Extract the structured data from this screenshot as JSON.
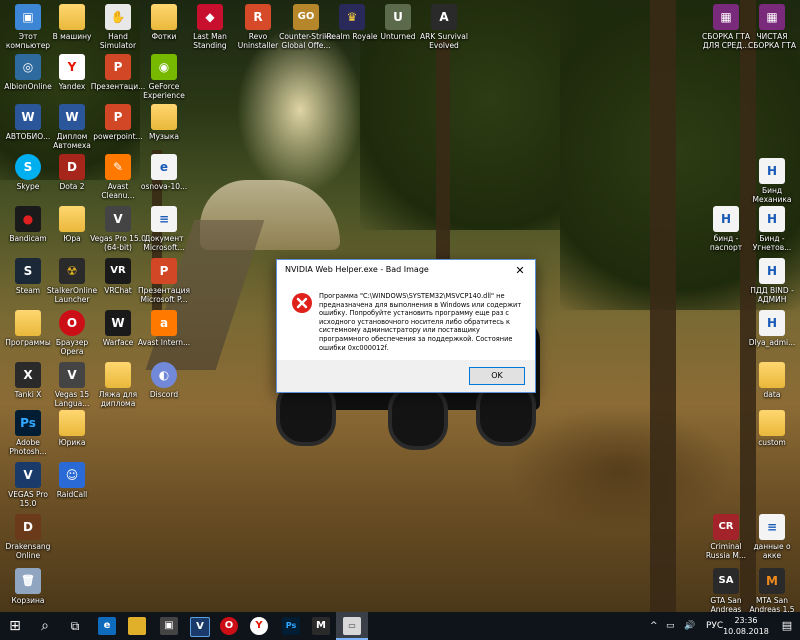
{
  "desktop": {
    "icons": [
      {
        "label": "Этот компьютер",
        "glyph": "▣",
        "bg": "#3d86d6"
      },
      {
        "label": "В машину",
        "glyph": "",
        "bg": ""
      },
      {
        "label": "Hand Simulator",
        "glyph": "✋",
        "bg": "#e8e8e8"
      },
      {
        "label": "Фотки",
        "glyph": "",
        "bg": ""
      },
      {
        "label": "Last Man Standing",
        "glyph": "◆",
        "bg": "#c8102e"
      },
      {
        "label": "Revo Uninstaller",
        "glyph": "R",
        "bg": "#d64a2a"
      },
      {
        "label": "Counter-Strike Global Offe...",
        "glyph": "GO",
        "bg": "#b5862a"
      },
      {
        "label": "Realm Royale",
        "glyph": "♛",
        "bg": "#2a2a5a"
      },
      {
        "label": "Unturned",
        "glyph": "U",
        "bg": "#5a6a4a"
      },
      {
        "label": "ARK Survival Evolved",
        "glyph": "A",
        "bg": "#2a2a2a"
      },
      {
        "label": "СБОРКА ГТА ДЛЯ СРЕД...",
        "glyph": "▦",
        "bg": "#7a2a7a"
      },
      {
        "label": "ЧИСТАЯ СБОРКА ГТА",
        "glyph": "▦",
        "bg": "#7a2a7a"
      },
      {
        "label": "AlbionOnline",
        "glyph": "◎",
        "bg": "#2f6a9e"
      },
      {
        "label": "Yandex",
        "glyph": "Y",
        "bg": "#ffffff"
      },
      {
        "label": "Презентаци...",
        "glyph": "P",
        "bg": "#d24726"
      },
      {
        "label": "GeForce Experience",
        "glyph": "◉",
        "bg": "#76b900"
      },
      {
        "label": "АВТОБИО...",
        "glyph": "W",
        "bg": "#2b579a"
      },
      {
        "label": "Диплом Автомеха",
        "glyph": "W",
        "bg": "#2b579a"
      },
      {
        "label": "powerpoint...",
        "glyph": "P",
        "bg": "#d24726"
      },
      {
        "label": "Музыка",
        "glyph": "",
        "bg": ""
      },
      {
        "label": "Skype",
        "glyph": "S",
        "bg": "#00aff0"
      },
      {
        "label": "Dota 2",
        "glyph": "D",
        "bg": "#a6261b"
      },
      {
        "label": "Avast Cleanu...",
        "glyph": "✎",
        "bg": "#ff7800"
      },
      {
        "label": "osnova-10...",
        "glyph": "e",
        "bg": "#f4f4f4"
      },
      {
        "label": "Бинд Механика",
        "glyph": "H",
        "bg": "#f4f4f4"
      },
      {
        "label": "Bandicam",
        "glyph": "●",
        "bg": "#1a1a1a"
      },
      {
        "label": "Юра",
        "glyph": "",
        "bg": ""
      },
      {
        "label": "Vegas Pro 15.0 (64-bit)",
        "glyph": "V",
        "bg": "#444444"
      },
      {
        "label": "Документ Microsoft...",
        "glyph": "≡",
        "bg": "#f4f4f4"
      },
      {
        "label": "бинд - паспорт",
        "glyph": "H",
        "bg": "#f4f4f4"
      },
      {
        "label": "Бинд - Угнетов...",
        "glyph": "H",
        "bg": "#f4f4f4"
      },
      {
        "label": "Steam",
        "glyph": "S",
        "bg": "#1b2838"
      },
      {
        "label": "StalkerOnline Launcher",
        "glyph": "☢",
        "bg": "#2a2a2a"
      },
      {
        "label": "VRChat",
        "glyph": "VR",
        "bg": "#1a1a1a"
      },
      {
        "label": "Презентация Microsoft P...",
        "glyph": "P",
        "bg": "#d24726"
      },
      {
        "label": "ПДД BIND - АДМИН",
        "glyph": "H",
        "bg": "#f4f4f4"
      },
      {
        "label": "Программы",
        "glyph": "",
        "bg": ""
      },
      {
        "label": "Браузер Opera",
        "glyph": "O",
        "bg": "#cc0f16"
      },
      {
        "label": "Warface",
        "glyph": "W",
        "bg": "#1a1a1a"
      },
      {
        "label": "Avast Intern...",
        "glyph": "a",
        "bg": "#ff7800"
      },
      {
        "label": "Dlya_admi...",
        "glyph": "H",
        "bg": "#f4f4f4"
      },
      {
        "label": "Tanki X",
        "glyph": "X",
        "bg": "#2a2a2a"
      },
      {
        "label": "Vegas 15 Langua...",
        "glyph": "V",
        "bg": "#444444"
      },
      {
        "label": "Ляжа для диплома",
        "glyph": "",
        "bg": ""
      },
      {
        "label": "Discord",
        "glyph": "◐",
        "bg": "#7289da"
      },
      {
        "label": "data",
        "glyph": "",
        "bg": ""
      },
      {
        "label": "Adobe Photosh...",
        "glyph": "Ps",
        "bg": "#001d34"
      },
      {
        "label": "Юрика",
        "glyph": "",
        "bg": ""
      },
      {
        "label": "custom",
        "glyph": "",
        "bg": ""
      },
      {
        "label": "VEGAS Pro 15.0",
        "glyph": "V",
        "bg": "#1a3a6a"
      },
      {
        "label": "RaidCall",
        "glyph": "☺",
        "bg": "#2a6ad6"
      },
      {
        "label": "Drakensang Online",
        "glyph": "D",
        "bg": "#6a3a1a"
      },
      {
        "label": "Criminal Russia M...",
        "glyph": "CR",
        "bg": "#a2232a"
      },
      {
        "label": "данные о акке",
        "glyph": "≡",
        "bg": "#f4f4f4"
      },
      {
        "label": "Корзина",
        "glyph": "🗑",
        "bg": "#8fa5c0"
      },
      {
        "label": "GTA San Andreas",
        "glyph": "SA",
        "bg": "#2a2a2a"
      },
      {
        "label": "MTA San Andreas 1.5",
        "glyph": "M",
        "bg": "#2a2a2a"
      }
    ]
  },
  "dialog": {
    "title": "NVIDIA Web Helper.exe - Bad Image",
    "close_glyph": "✕",
    "message": "Программа \"C:\\WINDOWS\\SYSTEM32\\MSVCP140.dll\" не предназначена для выполнения в Windows или содержит ошибку. Попробуйте установить программу еще раз с исходного установочного носителя либо обратитесь к системному администратору или поставщику программного обеспечения за поддержкой. Состояние ошибки 0xc000012f.",
    "ok_label": "OK"
  },
  "taskbar": {
    "start_glyph": "⊞",
    "search_glyph": "⌕",
    "taskview_glyph": "⧉",
    "language": "РУС",
    "time": "23:36",
    "date": "10.08.2018",
    "tray_glyphs": [
      "^",
      "▭",
      "🔊"
    ],
    "notif_glyph": "▤"
  }
}
